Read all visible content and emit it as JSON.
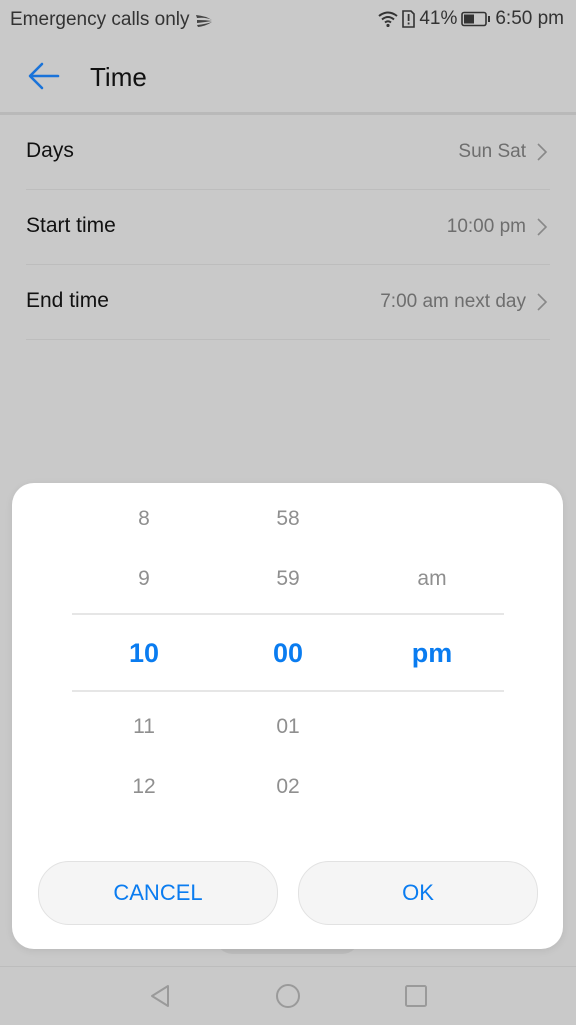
{
  "status_bar": {
    "carrier_text": "Emergency calls only",
    "battery_percent": "41%",
    "time": "6:50 pm",
    "icons": [
      "swipe-keyboard-icon",
      "wifi-icon",
      "sim-alert-icon",
      "battery-icon"
    ]
  },
  "toolbar": {
    "back_icon": "back-arrow-icon",
    "title": "Time"
  },
  "settings": [
    {
      "label": "Days",
      "value": "Sun Sat"
    },
    {
      "label": "Start time",
      "value": "10:00 pm"
    },
    {
      "label": "End time",
      "value": "7:00 am next day"
    }
  ],
  "time_picker": {
    "hours": {
      "above": [
        "8",
        "9"
      ],
      "selected": "10",
      "below": [
        "11",
        "12"
      ]
    },
    "minutes": {
      "above": [
        "58",
        "59"
      ],
      "selected": "00",
      "below": [
        "01",
        "02"
      ]
    },
    "period": {
      "above": [
        "",
        "am"
      ],
      "selected": "pm",
      "below": [
        "",
        ""
      ]
    },
    "accent_color": "#0a7cf0"
  },
  "dialog_buttons": {
    "cancel_label": "CANCEL",
    "ok_label": "OK"
  },
  "nav_bar": {
    "icons": [
      "back-triangle-icon",
      "home-circle-icon",
      "recents-square-icon"
    ]
  }
}
